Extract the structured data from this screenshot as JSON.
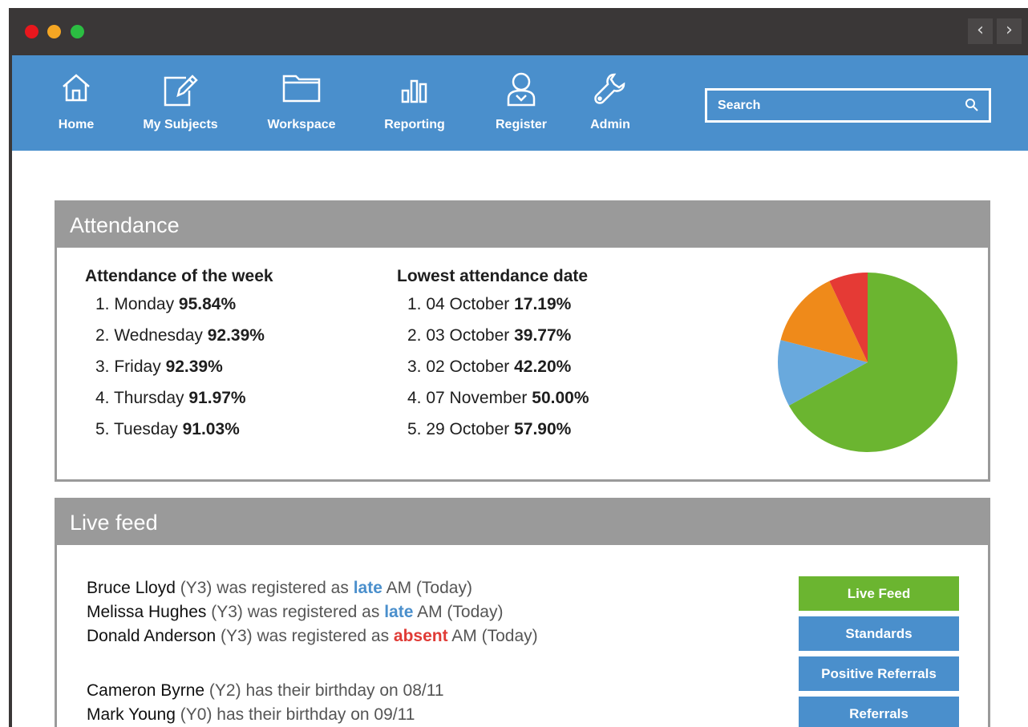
{
  "window": {
    "controls": [
      "close",
      "minimize",
      "maximize"
    ],
    "nav_prev": "back-icon",
    "nav_next": "forward-icon"
  },
  "nav": {
    "items": [
      {
        "label": "Home",
        "icon": "home-icon"
      },
      {
        "label": "My Subjects",
        "icon": "notebook-pencil-icon"
      },
      {
        "label": "Workspace",
        "icon": "folder-icon"
      },
      {
        "label": "Reporting",
        "icon": "bar-chart-icon"
      },
      {
        "label": "Register",
        "icon": "user-icon"
      },
      {
        "label": "Admin",
        "icon": "wrench-icon"
      }
    ],
    "search": {
      "placeholder": "Search",
      "icon": "search-icon"
    }
  },
  "attendance": {
    "title": "Attendance",
    "week": {
      "title": "Attendance of the week",
      "items": [
        {
          "rank": "1.",
          "day": "Monday",
          "value": "95.84%"
        },
        {
          "rank": "2.",
          "day": "Wednesday",
          "value": "92.39%"
        },
        {
          "rank": "3.",
          "day": "Friday",
          "value": "92.39%"
        },
        {
          "rank": "4.",
          "day": "Thursday",
          "value": "91.97%"
        },
        {
          "rank": "5.",
          "day": "Tuesday",
          "value": "91.03%"
        }
      ]
    },
    "lowest": {
      "title": "Lowest attendance date",
      "items": [
        {
          "rank": "1.",
          "date": "04 October",
          "value": "17.19%"
        },
        {
          "rank": "2.",
          "date": "03 October",
          "value": "39.77%"
        },
        {
          "rank": "3.",
          "date": "02 October",
          "value": "42.20%"
        },
        {
          "rank": "4.",
          "date": "07 November",
          "value": "50.00%"
        },
        {
          "rank": "5.",
          "date": "29 October",
          "value": "57.90%"
        }
      ]
    }
  },
  "chart_data": {
    "type": "pie",
    "slices": [
      {
        "value": 67,
        "color": "#6bb530"
      },
      {
        "value": 12,
        "color": "#69a9dd"
      },
      {
        "value": 14,
        "color": "#ef8a1a"
      },
      {
        "value": 7,
        "color": "#e53a35"
      }
    ]
  },
  "feed": {
    "title": "Live feed",
    "events": [
      {
        "name": "Bruce Lloyd",
        "year": "(Y3)",
        "text": "was registered as",
        "status": "late",
        "tail": "AM (Today)"
      },
      {
        "name": "Melissa Hughes",
        "year": "(Y3)",
        "text": "was registered as",
        "status": "late",
        "tail": "AM (Today)"
      },
      {
        "name": "Donald Anderson",
        "year": "(Y3)",
        "text": "was registered as",
        "status": "absent",
        "tail": "AM (Today)"
      }
    ],
    "birthdays": [
      {
        "name": "Cameron Byrne",
        "year": "(Y2)",
        "text": "has their birthday on 08/11"
      },
      {
        "name": "Mark Young",
        "year": "(Y0)",
        "text": "has their birthday on 09/11"
      }
    ],
    "buttons": [
      "Live Feed",
      "Standards",
      "Positive Referrals",
      "Referrals"
    ]
  },
  "colors": {
    "titlebar": "#3a3737",
    "navbar": "#4a8fcc",
    "panel_header": "#9a9a9a",
    "active_button": "#6bb530",
    "late": "#4a8fcc",
    "absent": "#e03b36"
  }
}
